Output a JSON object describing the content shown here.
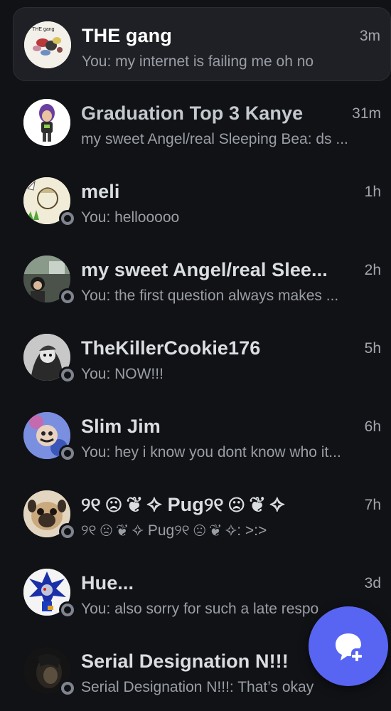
{
  "dms": [
    {
      "name": "THE gang",
      "time": "3m",
      "preview": "You: my internet is failing me oh no",
      "active": true,
      "group": true
    },
    {
      "name": "Graduation Top 3 Kanye",
      "time": "31m",
      "preview": "my sweet Angel/real Sleeping Bea: ds ...",
      "group": true
    },
    {
      "name": "meli",
      "time": "1h",
      "preview": "You: hellooooo"
    },
    {
      "name": "my sweet Angel/real Slee...",
      "time": "2h",
      "preview": "You: the first question always makes ..."
    },
    {
      "name": "TheKillerCookie176",
      "time": "5h",
      "preview": "You: NOW!!!"
    },
    {
      "name": "Slim Jim",
      "time": "6h",
      "preview": "You: hey i know you dont know who it..."
    },
    {
      "name": "୨୧ ☹ ❦ ✧ Pug୨୧ ☹ ❦ ✧",
      "time": "7h",
      "preview": "୨୧ ☹ ❦ ✧ Pug୨୧ ☹ ❦ ✧: >:>"
    },
    {
      "name": "Hue...",
      "time": "3d",
      "preview": "You: also sorry for such a late respo"
    },
    {
      "name": "Serial Designation N!!!",
      "time": "",
      "preview": "Serial Designation N!!!: That’s okay"
    }
  ],
  "avatar_texts": {
    "gang": "THE gang"
  },
  "fab": {
    "icon": "new-message-icon"
  },
  "colors": {
    "background": "#111216",
    "active_row": "#1f2026",
    "blurple": "#5865f2",
    "status_offline": "#80848e"
  }
}
